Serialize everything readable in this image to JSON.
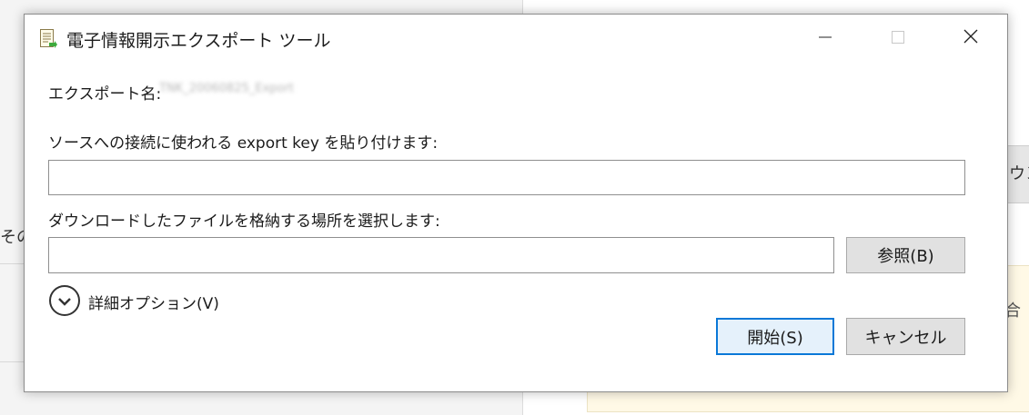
{
  "background": {
    "right_button_text": "ウン",
    "right_box_text": "合",
    "left_text": "そのメ"
  },
  "window": {
    "title": "電子情報開示エクスポート ツール",
    "app_icon": "document-icon",
    "minimize_icon": "minimize-icon",
    "maximize_icon": "maximize-icon",
    "close_icon": "close-icon"
  },
  "form": {
    "export_name_label": "エクスポート名:",
    "export_name_value": "TNK_20060825_Export",
    "export_key_label": "ソースへの接続に使われる export key を貼り付けます:",
    "export_key_value": "",
    "download_location_label": "ダウンロードしたファイルを格納する場所を選択します:",
    "download_location_value": "",
    "browse_button": "参照(B)",
    "advanced_options_label": "詳細オプション(V)",
    "advanced_options_icon": "chevron-down-circle-icon",
    "start_button": "開始(S)",
    "cancel_button": "キャンセル"
  },
  "colors": {
    "accent": "#0a78d7",
    "button_bg": "#e1e1e1",
    "dialog_bg": "#ffffff"
  }
}
